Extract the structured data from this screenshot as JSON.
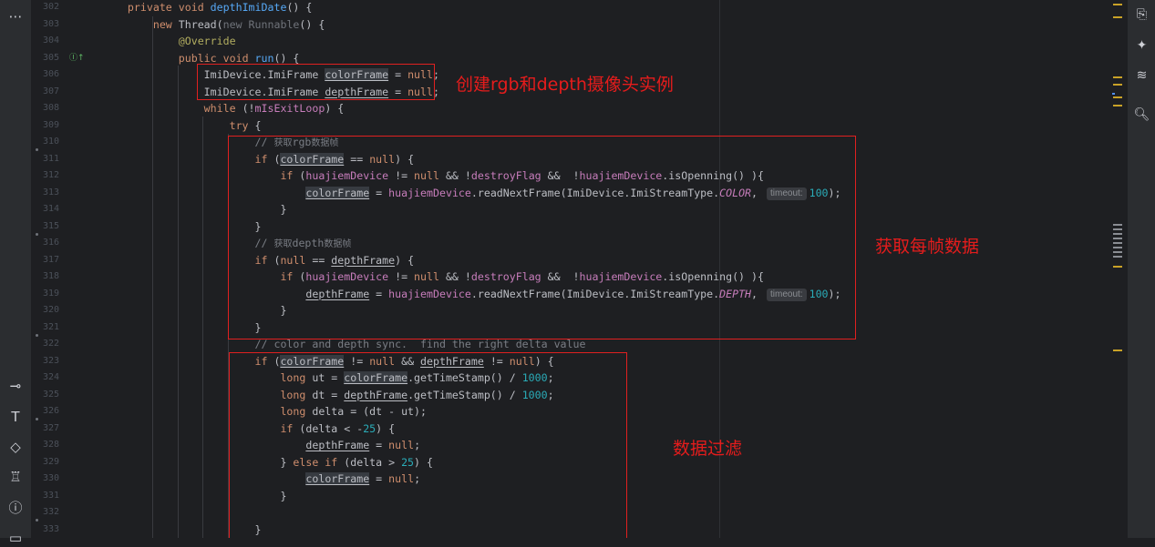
{
  "toolbars": {
    "left": [
      {
        "name": "more-icon",
        "glyph": "⋯"
      },
      {
        "name": "commit-icon",
        "glyph": "⊸"
      },
      {
        "name": "text-tool-icon",
        "glyph": "T"
      },
      {
        "name": "gem-icon",
        "glyph": "◇"
      },
      {
        "name": "build-icon",
        "glyph": "♖"
      },
      {
        "name": "problems-icon",
        "glyph": "ⓘ"
      },
      {
        "name": "terminal-icon",
        "glyph": "▭"
      }
    ],
    "right": [
      {
        "name": "notifications-icon",
        "glyph": "⎘"
      },
      {
        "name": "ai-assistant-icon",
        "glyph": "✦"
      },
      {
        "name": "database-icon",
        "glyph": "≋"
      },
      {
        "name": "search-doc-icon",
        "glyph": "🔍︎"
      }
    ]
  },
  "gutter": {
    "line_numbers": [
      "302",
      "303",
      "304",
      "305",
      "306",
      "307",
      "308",
      "309",
      "310",
      "311",
      "312",
      "313",
      "314",
      "315",
      "316",
      "317",
      "318",
      "319",
      "320",
      "321",
      "322",
      "323",
      "324",
      "325",
      "326",
      "327",
      "328",
      "329",
      "330",
      "331",
      "332",
      "333"
    ],
    "override_marker_glyph": "Ⓘ↑"
  },
  "code": {
    "lines": [
      [
        {
          "t": "    private ",
          "c": "kw"
        },
        {
          "t": "void ",
          "c": "kw"
        },
        {
          "t": "depthImiDate",
          "c": "fn"
        },
        {
          "t": "() {",
          "c": ""
        }
      ],
      [
        {
          "t": "        new ",
          "c": "kw"
        },
        {
          "t": "Thread(",
          "c": ""
        },
        {
          "t": "new Runnable",
          "c": "gray"
        },
        {
          "t": "() {",
          "c": ""
        }
      ],
      [
        {
          "t": "            @Override",
          "c": "ann"
        }
      ],
      [
        {
          "t": "            public ",
          "c": "kw"
        },
        {
          "t": "void ",
          "c": "kw"
        },
        {
          "t": "run",
          "c": "fn"
        },
        {
          "t": "() {",
          "c": ""
        }
      ],
      [
        {
          "t": "                ImiDevice.ImiFrame ",
          "c": ""
        },
        {
          "t": "colorFrame",
          "c": "hl"
        },
        {
          "t": " = ",
          "c": ""
        },
        {
          "t": "null",
          "c": "kw"
        },
        {
          "t": ";",
          "c": ""
        }
      ],
      [
        {
          "t": "                ImiDevice.ImiFrame ",
          "c": ""
        },
        {
          "t": "depthFrame",
          "c": "ul"
        },
        {
          "t": " = ",
          "c": ""
        },
        {
          "t": "null",
          "c": "kw"
        },
        {
          "t": ";",
          "c": ""
        }
      ],
      [
        {
          "t": "                while ",
          "c": "kw"
        },
        {
          "t": "(!",
          "c": ""
        },
        {
          "t": "mIsExitLoop",
          "c": "fld"
        },
        {
          "t": ") {",
          "c": ""
        }
      ],
      [
        {
          "t": "                    try ",
          "c": "kw"
        },
        {
          "t": "{",
          "c": ""
        }
      ],
      [
        {
          "t": "                        // ",
          "c": "cmt"
        },
        {
          "t": "获取",
          "c": "cmt-cn"
        },
        {
          "t": "rgb",
          "c": "cmt"
        },
        {
          "t": "数据帧",
          "c": "cmt-cn"
        }
      ],
      [
        {
          "t": "                        if ",
          "c": "kw"
        },
        {
          "t": "(",
          "c": ""
        },
        {
          "t": "colorFrame",
          "c": "hl"
        },
        {
          "t": " == ",
          "c": ""
        },
        {
          "t": "null",
          "c": "kw"
        },
        {
          "t": ") {",
          "c": ""
        }
      ],
      [
        {
          "t": "                            if ",
          "c": "kw"
        },
        {
          "t": "(",
          "c": ""
        },
        {
          "t": "huajiemDevice",
          "c": "fld"
        },
        {
          "t": " != ",
          "c": ""
        },
        {
          "t": "null",
          "c": "kw"
        },
        {
          "t": " && !",
          "c": ""
        },
        {
          "t": "destroyFlag",
          "c": "fld"
        },
        {
          "t": " &&  !",
          "c": ""
        },
        {
          "t": "huajiemDevice",
          "c": "fld"
        },
        {
          "t": ".isOpenning() ){",
          "c": ""
        }
      ],
      [
        {
          "t": "                                ",
          "c": ""
        },
        {
          "t": "colorFrame",
          "c": "hl"
        },
        {
          "t": " = ",
          "c": ""
        },
        {
          "t": "huajiemDevice",
          "c": "fld"
        },
        {
          "t": ".readNextFrame(ImiDevice.ImiStreamType.",
          "c": ""
        },
        {
          "t": "COLOR",
          "c": "const"
        },
        {
          "t": ",",
          "c": ""
        },
        {
          "t": "timeout:",
          "c": "hint"
        },
        {
          "t": "100",
          "c": "num"
        },
        {
          "t": ");",
          "c": ""
        }
      ],
      [
        {
          "t": "                            }",
          "c": ""
        }
      ],
      [
        {
          "t": "                        }",
          "c": ""
        }
      ],
      [
        {
          "t": "                        // ",
          "c": "cmt"
        },
        {
          "t": "获取",
          "c": "cmt-cn"
        },
        {
          "t": "depth",
          "c": "cmt"
        },
        {
          "t": "数据帧",
          "c": "cmt-cn"
        }
      ],
      [
        {
          "t": "                        if ",
          "c": "kw"
        },
        {
          "t": "(",
          "c": ""
        },
        {
          "t": "null",
          "c": "kw"
        },
        {
          "t": " == ",
          "c": ""
        },
        {
          "t": "depthFrame",
          "c": "ul"
        },
        {
          "t": ") {",
          "c": ""
        }
      ],
      [
        {
          "t": "                            if ",
          "c": "kw"
        },
        {
          "t": "(",
          "c": ""
        },
        {
          "t": "huajiemDevice",
          "c": "fld"
        },
        {
          "t": " != ",
          "c": ""
        },
        {
          "t": "null",
          "c": "kw"
        },
        {
          "t": " && !",
          "c": ""
        },
        {
          "t": "destroyFlag",
          "c": "fld"
        },
        {
          "t": " &&  !",
          "c": ""
        },
        {
          "t": "huajiemDevice",
          "c": "fld"
        },
        {
          "t": ".isOpenning() ){",
          "c": ""
        }
      ],
      [
        {
          "t": "                                ",
          "c": ""
        },
        {
          "t": "depthFrame",
          "c": "ul"
        },
        {
          "t": " = ",
          "c": ""
        },
        {
          "t": "huajiemDevice",
          "c": "fld"
        },
        {
          "t": ".readNextFrame(ImiDevice.ImiStreamType.",
          "c": ""
        },
        {
          "t": "DEPTH",
          "c": "const"
        },
        {
          "t": ",",
          "c": ""
        },
        {
          "t": "timeout:",
          "c": "hint"
        },
        {
          "t": "100",
          "c": "num"
        },
        {
          "t": ");",
          "c": ""
        }
      ],
      [
        {
          "t": "                            }",
          "c": ""
        }
      ],
      [
        {
          "t": "                        }",
          "c": ""
        }
      ],
      [
        {
          "t": "                        // color and depth sync.  find the right delta value",
          "c": "cmt"
        }
      ],
      [
        {
          "t": "                        if ",
          "c": "kw"
        },
        {
          "t": "(",
          "c": ""
        },
        {
          "t": "colorFrame",
          "c": "hl"
        },
        {
          "t": " != ",
          "c": ""
        },
        {
          "t": "null",
          "c": "kw"
        },
        {
          "t": " && ",
          "c": ""
        },
        {
          "t": "depthFrame",
          "c": "ul"
        },
        {
          "t": " != ",
          "c": ""
        },
        {
          "t": "null",
          "c": "kw"
        },
        {
          "t": ") {",
          "c": ""
        }
      ],
      [
        {
          "t": "                            long ",
          "c": "kw"
        },
        {
          "t": "ut = ",
          "c": ""
        },
        {
          "t": "colorFrame",
          "c": "hl"
        },
        {
          "t": ".getTimeStamp() / ",
          "c": ""
        },
        {
          "t": "1000",
          "c": "num"
        },
        {
          "t": ";",
          "c": ""
        }
      ],
      [
        {
          "t": "                            long ",
          "c": "kw"
        },
        {
          "t": "dt = ",
          "c": ""
        },
        {
          "t": "depthFrame",
          "c": "ul"
        },
        {
          "t": ".getTimeStamp() / ",
          "c": ""
        },
        {
          "t": "1000",
          "c": "num"
        },
        {
          "t": ";",
          "c": ""
        }
      ],
      [
        {
          "t": "                            long ",
          "c": "kw"
        },
        {
          "t": "delta = (dt - ut);",
          "c": ""
        }
      ],
      [
        {
          "t": "                            if ",
          "c": "kw"
        },
        {
          "t": "(delta < -",
          "c": ""
        },
        {
          "t": "25",
          "c": "num"
        },
        {
          "t": ") {",
          "c": ""
        }
      ],
      [
        {
          "t": "                                ",
          "c": ""
        },
        {
          "t": "depthFrame",
          "c": "ul"
        },
        {
          "t": " = ",
          "c": ""
        },
        {
          "t": "null",
          "c": "kw"
        },
        {
          "t": ";",
          "c": ""
        }
      ],
      [
        {
          "t": "                            } ",
          "c": ""
        },
        {
          "t": "else if ",
          "c": "kw"
        },
        {
          "t": "(delta > ",
          "c": ""
        },
        {
          "t": "25",
          "c": "num"
        },
        {
          "t": ") {",
          "c": ""
        }
      ],
      [
        {
          "t": "                                ",
          "c": ""
        },
        {
          "t": "colorFrame",
          "c": "hl"
        },
        {
          "t": " = ",
          "c": ""
        },
        {
          "t": "null",
          "c": "kw"
        },
        {
          "t": ";",
          "c": ""
        }
      ],
      [
        {
          "t": "                            }",
          "c": ""
        }
      ],
      [
        {
          "t": "",
          "c": ""
        }
      ],
      [
        {
          "t": "                        }",
          "c": ""
        }
      ]
    ]
  },
  "annotations": {
    "create_instances": "创建rgb和depth摄像头实例",
    "get_frame_data": "获取每帧数据",
    "data_filter": "数据过滤"
  },
  "colors": {
    "annotation_red": "#e51c1c",
    "editor_bg": "#1e1f22",
    "scroll_mark": "#c9a227"
  }
}
